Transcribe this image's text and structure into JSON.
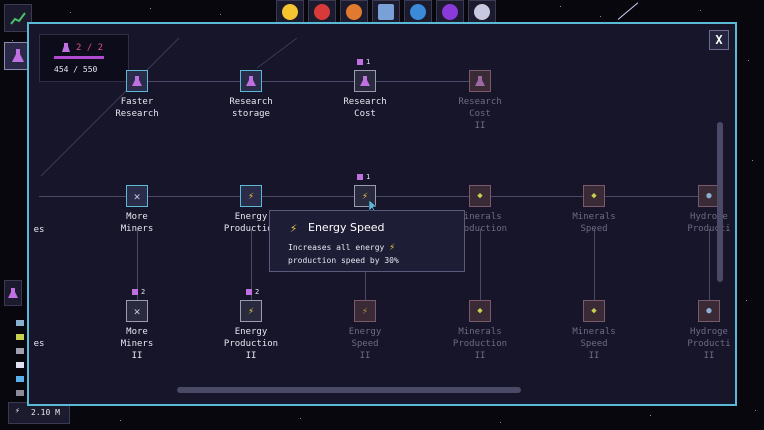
{
  "topbar": {
    "planets": [
      {
        "icon": "sun-icon",
        "color": "#f4c431"
      },
      {
        "icon": "red-planet-icon",
        "color": "#d83a3a"
      },
      {
        "icon": "orange-planet-icon",
        "color": "#e07a2e"
      },
      {
        "icon": "satellite-icon",
        "color": "#7aa0d8"
      },
      {
        "icon": "earth-icon",
        "color": "#3a8ad8"
      },
      {
        "icon": "purple-planet-icon",
        "color": "#8a3ad8"
      },
      {
        "icon": "moon-icon",
        "color": "#c8c8e0"
      }
    ]
  },
  "research": {
    "count": "2 / 2",
    "progress": "454 / 550",
    "progress_fraction": 0.825
  },
  "close_label": "X",
  "nodes": {
    "faster_research": {
      "label": "Faster\nResearch"
    },
    "research_storage": {
      "label": "Research\nstorage"
    },
    "research_cost": {
      "label": "Research\nCost",
      "cost": "1"
    },
    "research_cost_2": {
      "label": "Research\nCost\nII"
    },
    "row2_left": {
      "label": "es"
    },
    "more_miners": {
      "label": "More\nMiners"
    },
    "energy_production": {
      "label": "Energy\nProduction"
    },
    "energy_speed": {
      "cost": "1"
    },
    "minerals_production": {
      "label": "Minerals\nProduction"
    },
    "minerals_speed": {
      "label": "Minerals\nSpeed"
    },
    "hydrogen_production": {
      "label": "Hydroge\nProducti"
    },
    "row3_left": {
      "label": "es"
    },
    "more_miners_2": {
      "label": "More\nMiners\nII",
      "cost": "2"
    },
    "energy_production_2": {
      "label": "Energy\nProduction\nII",
      "cost": "2"
    },
    "energy_speed_2": {
      "label": "Energy\nSpeed\nII"
    },
    "minerals_production_2": {
      "label": "Minerals\nProduction\nII"
    },
    "minerals_speed_2": {
      "label": "Minerals\nSpeed\nII"
    },
    "hydrogen_production_2": {
      "label": "Hydroge\nProducti\nII"
    }
  },
  "tooltip": {
    "title": "Energy Speed",
    "desc_line1": "Increases all energy",
    "desc_line2": "production speed by 30%"
  },
  "energy_rate": "2.10 M",
  "colors": {
    "accent": "#5bb8d6",
    "energy": "#f2c84a",
    "research": "#c070e0"
  }
}
